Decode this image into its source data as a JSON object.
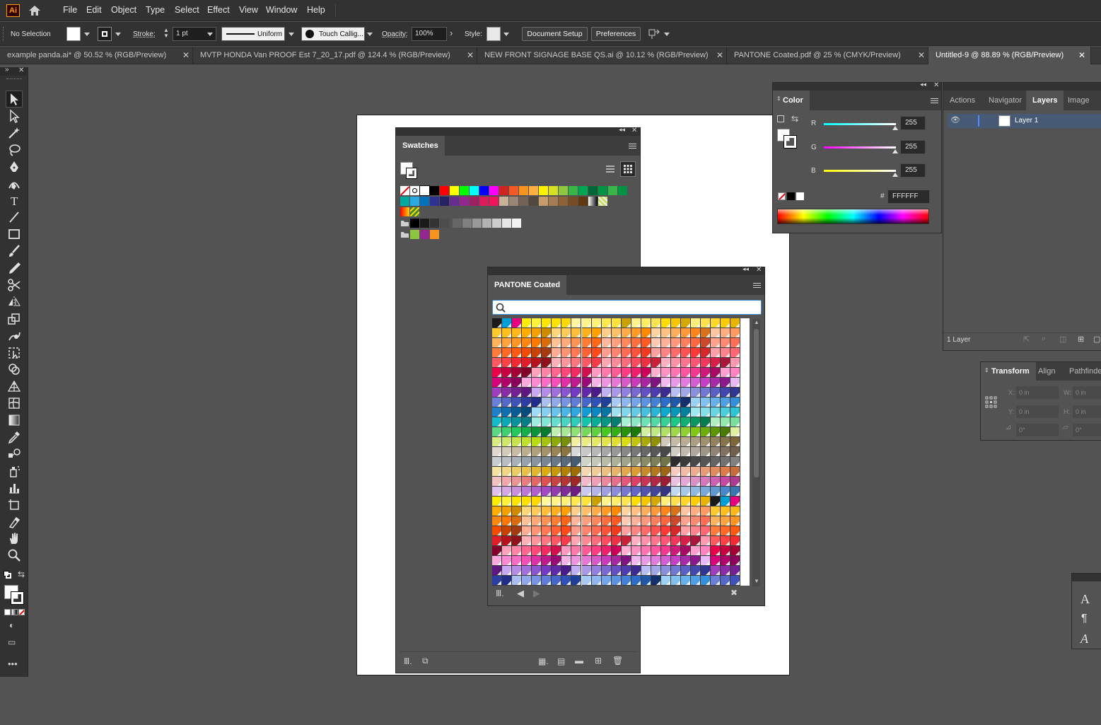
{
  "menubar": {
    "logo": "Ai",
    "items": [
      "File",
      "Edit",
      "Object",
      "Type",
      "Select",
      "Effect",
      "View",
      "Window",
      "Help"
    ]
  },
  "control_bar": {
    "selection": "No Selection",
    "stroke_label": "Stroke:",
    "stroke_weight": "1 pt",
    "stroke_profile": "Uniform",
    "brush": "Touch Callig...",
    "opacity_label": "Opacity:",
    "opacity_value": "100%",
    "style_label": "Style:",
    "document_setup": "Document Setup",
    "preferences": "Preferences"
  },
  "doc_tabs": [
    {
      "label": "example panda.ai* @ 50.52 % (RGB/Preview)",
      "active": false
    },
    {
      "label": "MVTP  HONDA Van PROOF Est  7_20_17.pdf @ 124.4 % (RGB/Preview)",
      "active": false
    },
    {
      "label": "NEW FRONT SIGNAGE BASE QS.ai @ 10.12 % (RGB/Preview)",
      "active": false
    },
    {
      "label": "PANTONE Coated.pdf @ 25 % (CMYK/Preview)",
      "active": false
    },
    {
      "label": "Untitled-9 @ 88.89 % (RGB/Preview)",
      "active": true
    }
  ],
  "tools": [
    "selection-tool",
    "direct-selection-tool",
    "magic-wand-tool",
    "lasso-tool",
    "pen-tool",
    "curvature-tool",
    "type-tool",
    "line-tool",
    "rectangle-tool",
    "paintbrush-tool",
    "pencil-tool",
    "scissors-tool",
    "reflect-tool",
    "scale-tool",
    "warp-tool",
    "free-transform-tool",
    "shape-builder-tool",
    "perspective-grid-tool",
    "mesh-tool",
    "gradient-tool",
    "eyedropper-tool",
    "blend-tool",
    "symbol-sprayer-tool",
    "column-graph-tool",
    "artboard-tool",
    "slice-tool",
    "hand-tool",
    "zoom-tool"
  ],
  "swatches_panel": {
    "tab": "Swatches",
    "row1": [
      "#ff0000",
      "#ffff00",
      "#00ff00",
      "#00ffff",
      "#0000ff",
      "#ff00ff",
      "#ed1c24",
      "#f7941d",
      "#fff200",
      "#8dc63f",
      "#39b54a",
      "#00a651",
      "#00a99d",
      "#00aeef",
      "#0072bc",
      "#2e3192",
      "#662d91",
      "#92278f",
      "#ec008c",
      "#ed145b",
      "#c69c6d",
      "#a67c52",
      "#8c6239",
      "#603813",
      "#754c24"
    ],
    "row1b": [
      "#d0251e",
      "#f15a24",
      "#f7941d",
      "#fbb040",
      "#fff200",
      "#d7df23",
      "#8dc63f",
      "#39b54a",
      "#00a651",
      "#006838",
      "#009444"
    ],
    "row2": [
      "#00a99d",
      "#27aae1",
      "#0072bc",
      "#2e3192",
      "#262262",
      "#662d91",
      "#92278f",
      "#9e1f63",
      "#da1c5c",
      "#ed145b",
      "#c7b299",
      "#998675",
      "#736357",
      "#534741",
      "#c69c6d",
      "#a67c52",
      "#8c6239",
      "#754c24",
      "#603813",
      "#42210b"
    ],
    "grays": [
      "#000000",
      "#1a1a1a",
      "#333333",
      "#4d4d4d",
      "#666666",
      "#808080",
      "#999999",
      "#b3b3b3",
      "#cccccc",
      "#e6e6e6",
      "#f2f2f2"
    ],
    "group2": [
      "#8cc63f",
      "#93278f",
      "#f7931e"
    ]
  },
  "pantone_panel": {
    "tab": "PANTONE Coated",
    "search_placeholder": "",
    "rows": [
      [
        "#1a1a1a",
        "#00a0d6",
        "#e6007e",
        "#ffed00",
        "#fff23b",
        "#ffe600",
        "#ffe100",
        "#ffd800",
        "#fff6a0",
        "#fff38a",
        "#fff07a",
        "#ffe94d",
        "#ffe23a",
        "#c9a200",
        "#fff38c",
        "#ffed66",
        "#ffe54d",
        "#ffdd00",
        "#f6c700",
        "#d6a900",
        "#ffef7a",
        "#ffe14d",
        "#ffd72a",
        "#ffcc00",
        "#e8b400"
      ],
      [
        "#ffc82e",
        "#ffbf1f",
        "#ffb81a",
        "#ffae00",
        "#f2a100",
        "#cf8b00",
        "#ffd77a",
        "#ffcc5c",
        "#ffbf3d",
        "#ffb01f",
        "#ff9f00",
        "#ffce8a",
        "#ffc06a",
        "#ffad48",
        "#ff9b26",
        "#ff8900",
        "#ffd3a0",
        "#ffc282",
        "#ffae5e",
        "#ff9a3b",
        "#ff8419",
        "#d9731a",
        "#ffc4a2",
        "#ffae82",
        "#ff9a62"
      ],
      [
        "#ffb35c",
        "#ffa340",
        "#ff9626",
        "#ff870d",
        "#ff7900",
        "#d96c0b",
        "#ffc196",
        "#ffaa78",
        "#ff9355",
        "#ff7d35",
        "#ff6716",
        "#ffb89e",
        "#ffa07f",
        "#ff885e",
        "#ff7040",
        "#ff5a23",
        "#ffcab5",
        "#ffb19a",
        "#ff987d",
        "#ff7f5f",
        "#ff6642",
        "#cc4a2a",
        "#ffa38f",
        "#ff8a74",
        "#ff6f58"
      ],
      [
        "#ff7b3b",
        "#ff6a26",
        "#ff5a12",
        "#f24c00",
        "#c94300",
        "#a33a10",
        "#ffae95",
        "#ff9474",
        "#ff7a55",
        "#ff6136",
        "#ff4a1a",
        "#ff9e8e",
        "#ff8571",
        "#ff6b55",
        "#ff5238",
        "#f23a1f",
        "#ffa0a0",
        "#ff8585",
        "#ff6b6b",
        "#ff5252",
        "#ff3838",
        "#d62828",
        "#ff9fa8",
        "#ff838d",
        "#ff6774"
      ],
      [
        "#ff5a5f",
        "#ff4148",
        "#f52934",
        "#e11d28",
        "#b5121b",
        "#8f1119",
        "#ffb3b8",
        "#ff969c",
        "#ff7880",
        "#ff5a64",
        "#f53c48",
        "#ffa8b3",
        "#ff8a97",
        "#ff6c7b",
        "#ff4d5f",
        "#ef2f44",
        "#c9213a",
        "#ffb0c1",
        "#ff92a8",
        "#ff748f",
        "#ff5676",
        "#f0385c",
        "#d61f48",
        "#a8173b",
        "#ff98b0"
      ],
      [
        "#e8004b",
        "#c8003f",
        "#a50034",
        "#820029",
        "#ffa3bd",
        "#ff85a6",
        "#ff678f",
        "#ff4978",
        "#f22b62",
        "#d10f4c",
        "#ff99bf",
        "#ff7aaa",
        "#ff5c96",
        "#ff3d82",
        "#f01f6d",
        "#cc0058",
        "#ffb0d2",
        "#ff92c2",
        "#ff74b1",
        "#ff56a0",
        "#f2388f",
        "#cf1a7c",
        "#a80a63",
        "#ff9fd0",
        "#ff82c1"
      ],
      [
        "#d6007a",
        "#b0006a",
        "#8a005b",
        "#ffa8df",
        "#ff8ad2",
        "#ff6cc5",
        "#f54fb8",
        "#e030a6",
        "#c01a8f",
        "#9a0a76",
        "#f5b3e8",
        "#ee95df",
        "#e577d5",
        "#d859c8",
        "#c93bba",
        "#a826a0",
        "#7f1480",
        "#f2b8f0",
        "#e99ae7",
        "#df7cdd",
        "#d35ed2",
        "#c540c5",
        "#a82aa8",
        "#8a1a8c",
        "#e8b8f5"
      ],
      [
        "#a03cbe",
        "#8a2ca8",
        "#732094",
        "#5e1680",
        "#c8a8f0",
        "#b58ce6",
        "#a070db",
        "#8b55cf",
        "#763ac2",
        "#6128aa",
        "#4b1a8a",
        "#bfb0f2",
        "#a898e8",
        "#9180dd",
        "#7a68d1",
        "#6450c4",
        "#4f3bb0",
        "#3c2a90",
        "#b8bff2",
        "#a0a8e8",
        "#8890de",
        "#7078d2",
        "#5860c5",
        "#4048b0",
        "#303690"
      ],
      [
        "#6a7fd6",
        "#5468c8",
        "#3f52b8",
        "#2c3ea3",
        "#1f2f88",
        "#aabff0",
        "#91a9e8",
        "#7893df",
        "#5f7dd5",
        "#4667c9",
        "#2f52b8",
        "#1f3f99",
        "#a8c8f5",
        "#8fb6ef",
        "#76a4e8",
        "#5d92e0",
        "#4480d6",
        "#2d6cc8",
        "#1f58a8",
        "#132f6e",
        "#9cd0f5",
        "#82c0f0",
        "#68b0ea",
        "#4ea0e3",
        "#3590da"
      ],
      [
        "#1f7fc8",
        "#0f6db0",
        "#085c96",
        "#044a7a",
        "#a0dcf5",
        "#84cff0",
        "#68c2ec",
        "#4cb5e6",
        "#30a8df",
        "#149ad6",
        "#0a87c0",
        "#0573a3",
        "#9fe0f0",
        "#82d5ea",
        "#65cae4",
        "#48bfdd",
        "#2bb4d6",
        "#0fa8cd",
        "#0895b8",
        "#057f9e",
        "#a0e8f0",
        "#84dfe9",
        "#68d6e2",
        "#4ccdda",
        "#30c4d2"
      ],
      [
        "#14bbc9",
        "#0aa8b5",
        "#07939e",
        "#057d86",
        "#a0ece3",
        "#84e4d8",
        "#68dccd",
        "#4cd4c2",
        "#30ccb7",
        "#14c4ac",
        "#0aae98",
        "#079683",
        "#057e6e",
        "#a8f0d3",
        "#8ce8c4",
        "#70e0b5",
        "#54d8a6",
        "#38d097",
        "#1cc888",
        "#10b074",
        "#0a9661",
        "#067d4f",
        "#b0f0c0",
        "#94e8ac",
        "#78e098"
      ],
      [
        "#5cd884",
        "#40d070",
        "#24c85c",
        "#14ae4b",
        "#0c943c",
        "#067a2e",
        "#c0f0b0",
        "#a8e894",
        "#90e078",
        "#78d85c",
        "#60d040",
        "#48c824",
        "#36ae18",
        "#27940f",
        "#1a7a08",
        "#d0f0a0",
        "#c0e884",
        "#b0e068",
        "#a0d84c",
        "#90d030",
        "#80c814",
        "#6eae0c",
        "#5c9406",
        "#4a7a03",
        "#e0f0a0"
      ],
      [
        "#d8ec84",
        "#d0e868",
        "#c8e44c",
        "#c0e030",
        "#b8dc14",
        "#a4c40c",
        "#8eaa06",
        "#789003",
        "#f0f0a0",
        "#ecec84",
        "#e8e868",
        "#e4e44c",
        "#e0e030",
        "#dcdc14",
        "#c4c40c",
        "#aaaa06",
        "#909003",
        "#d0c8b8",
        "#c4baa6",
        "#b8ac94",
        "#ac9e82",
        "#a09070",
        "#94825e",
        "#88744c",
        "#7c663a"
      ],
      [
        "#e0d8cc",
        "#d4cab8",
        "#c8bca4",
        "#bcae90",
        "#b0a07c",
        "#a49268",
        "#988454",
        "#8c7640",
        "#d8d8d8",
        "#c8c8c8",
        "#b8b8b8",
        "#a8a8a8",
        "#989898",
        "#888888",
        "#787878",
        "#686868",
        "#585858",
        "#484848",
        "#d0ccc4",
        "#c0bab0",
        "#b0a89c",
        "#a09688",
        "#908474",
        "#807260",
        "#70604c"
      ],
      [
        "#c8ccd0",
        "#b8bec4",
        "#a8b0b8",
        "#98a2ac",
        "#8894a0",
        "#788694",
        "#687888",
        "#586a7c",
        "#485c70",
        "#d0d4c8",
        "#c4c8b8",
        "#b8bca8",
        "#acb098",
        "#a0a488",
        "#949878",
        "#888c68",
        "#7c8058",
        "#707448",
        "#2c2c2c",
        "#3a3a3a",
        "#484848",
        "#565656",
        "#646464",
        "#727272",
        "#808080"
      ],
      [
        "#f5e3a0",
        "#f0d884",
        "#ebcd68",
        "#e6c24c",
        "#e1b730",
        "#dcac14",
        "#c7970c",
        "#b28206",
        "#9d6d03",
        "#f5d8b0",
        "#f0cc98",
        "#ebc080",
        "#e6b468",
        "#e1a850",
        "#dc9c38",
        "#c78a2c",
        "#b27820",
        "#9d6614",
        "#f5ccc0",
        "#f0bca8",
        "#ebac90",
        "#e69c78",
        "#e18c60",
        "#dc7c48",
        "#c76c3c"
      ],
      [
        "#f5c0c0",
        "#f0aaaa",
        "#eb9494",
        "#e67e7e",
        "#e16868",
        "#dc5252",
        "#c74444",
        "#b23636",
        "#9d2828",
        "#f5b8c8",
        "#f0a0b4",
        "#eb88a0",
        "#e6708c",
        "#e15878",
        "#dc4064",
        "#c73454",
        "#b22844",
        "#9d1c34",
        "#ecc0e0",
        "#e4a8d4",
        "#dc90c8",
        "#d478bc",
        "#cc60b0",
        "#c448a4",
        "#ae3a92"
      ],
      [
        "#e0c0ec",
        "#d4a8e4",
        "#c890dc",
        "#bc78d4",
        "#b060cc",
        "#a448c4",
        "#923aae",
        "#802c98",
        "#6e1e82",
        "#c8c8f0",
        "#b4b4e8",
        "#a0a0e0",
        "#8c8cd8",
        "#7878d0",
        "#6464c8",
        "#5454b0",
        "#444498",
        "#343480",
        "#c0d8f0",
        "#a8c8e8",
        "#90b8e0",
        "#78a8d8",
        "#6098d0",
        "#4888c8",
        "#3a76b0"
      ]
    ]
  },
  "color_panel": {
    "tab": "Color",
    "r_label": "R",
    "r_value": "255",
    "g_label": "G",
    "g_value": "255",
    "b_label": "B",
    "b_value": "255",
    "hex_label": "#",
    "hex_value": "FFFFFF"
  },
  "layers_panel": {
    "tabs": [
      "Actions",
      "Navigator",
      "Layers",
      "Image Tra"
    ],
    "active_tab": "Layers",
    "layer_name": "Layer 1",
    "count": "1 Layer"
  },
  "transform_panel": {
    "tabs": [
      "Transform",
      "Align",
      "Pathfinde"
    ],
    "x_label": "X:",
    "x_value": "0 in",
    "y_label": "Y:",
    "y_value": "0 in",
    "w_label": "W:",
    "w_value": "0 in",
    "h_label": "H:",
    "h_value": "0 in",
    "angle_value": "0°",
    "shear_value": "0°"
  },
  "char_panel": {
    "items": [
      "A",
      "¶",
      "A"
    ]
  }
}
